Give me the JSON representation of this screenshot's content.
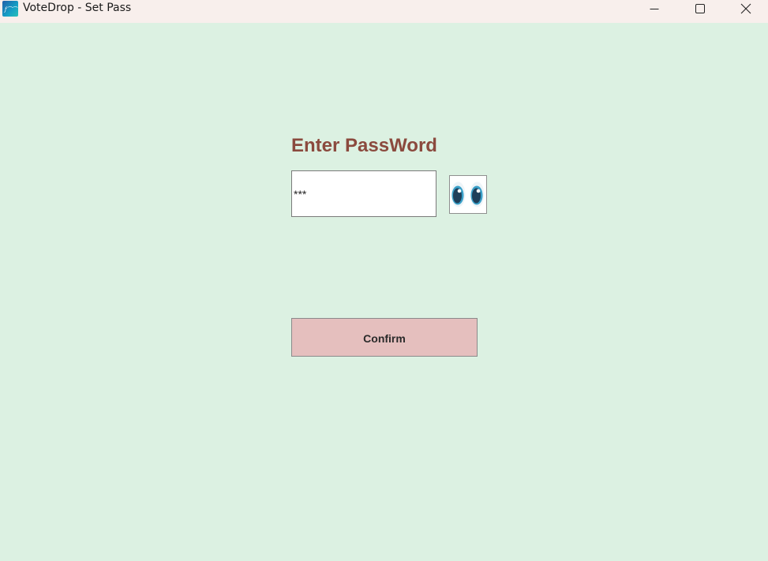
{
  "window": {
    "title": "VoteDrop - Set Pass",
    "icon": "votedrop-app-icon",
    "controls": {
      "minimize_icon": "minimize-icon",
      "maximize_icon": "maximize-icon",
      "close_icon": "close-icon"
    }
  },
  "form": {
    "heading": "Enter PassWord",
    "password": {
      "value": "***"
    },
    "toggle_visibility_icon": "eyes-icon",
    "confirm_label": "Confirm"
  },
  "colors": {
    "background": "#dcf1e2",
    "titlebar": "#f8efec",
    "heading": "#8b4a3e",
    "confirm_button": "#e5bfbe"
  }
}
